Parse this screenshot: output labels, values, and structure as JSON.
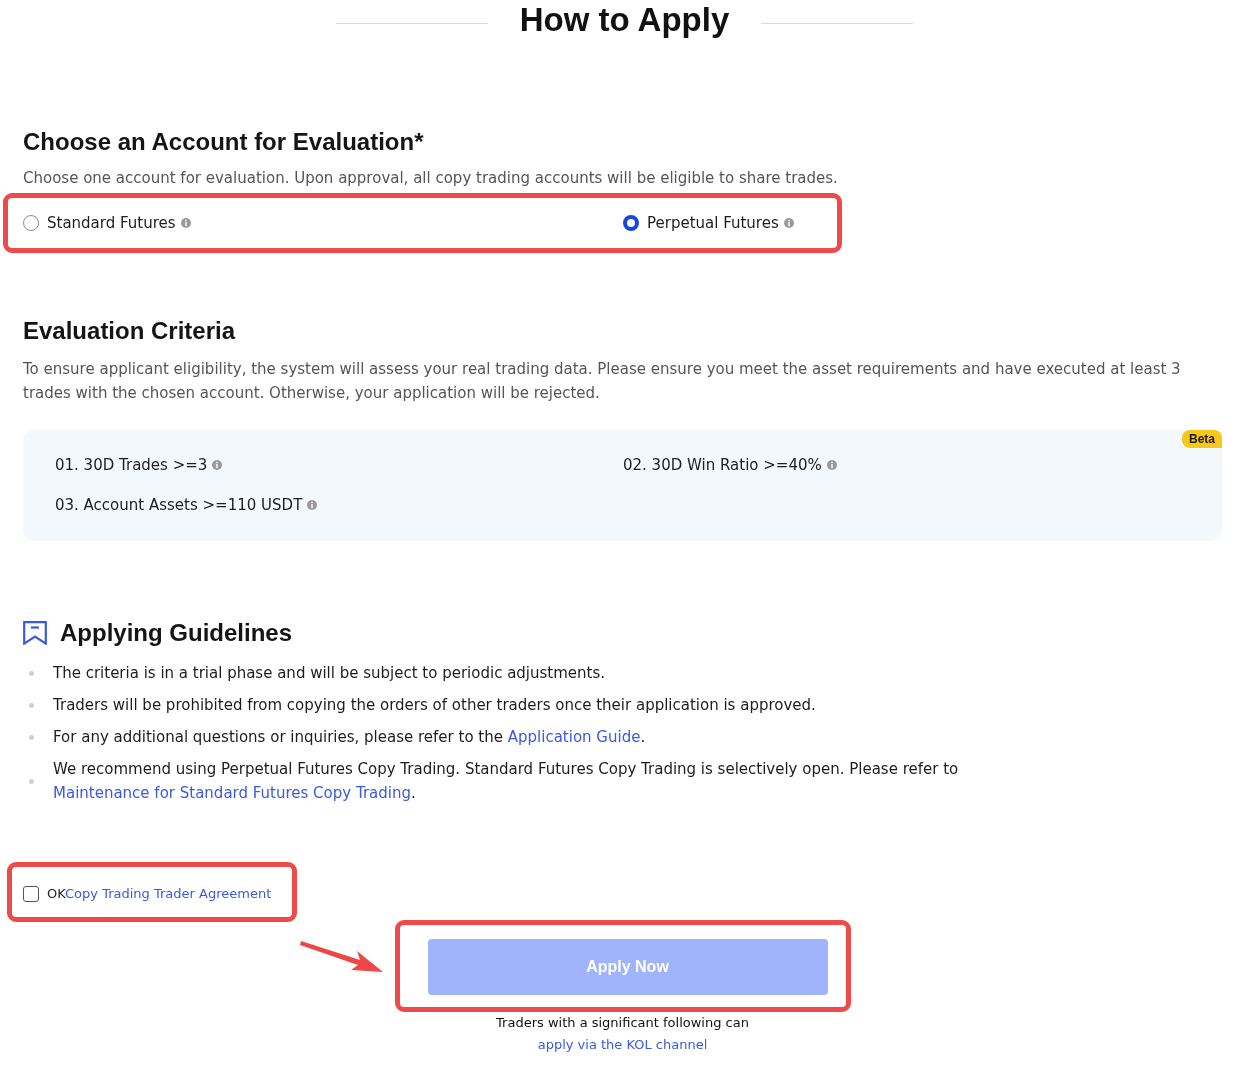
{
  "title": "How to Apply",
  "account": {
    "heading": "Choose an Account for Evaluation*",
    "description": "Choose one account for evaluation. Upon approval, all copy trading accounts will be eligible to share trades.",
    "options": [
      {
        "label": "Standard Futures",
        "selected": false
      },
      {
        "label": "Perpetual Futures",
        "selected": true
      }
    ]
  },
  "criteria": {
    "heading": "Evaluation Criteria",
    "description": "To ensure applicant eligibility, the system will assess your real trading data. Please ensure you meet the asset requirements and have executed at least 3 trades with the chosen account. Otherwise, your application will be rejected.",
    "badge": "Beta",
    "items": [
      "01. 30D Trades >=3",
      "02. 30D Win Ratio >=40%",
      "03. Account Assets >=110 USDT"
    ]
  },
  "guidelines": {
    "heading": "Applying Guidelines",
    "items": [
      [
        {
          "kind": "text",
          "text": "The criteria is in a trial phase and will be subject to periodic adjustments."
        }
      ],
      [
        {
          "kind": "text",
          "text": "Traders will be prohibited from copying the orders of other traders once their application is approved."
        }
      ],
      [
        {
          "kind": "text",
          "text": "For any additional questions or inquiries, please refer to the "
        },
        {
          "kind": "link",
          "text": "Application Guide"
        },
        {
          "kind": "text",
          "text": "."
        }
      ],
      [
        {
          "kind": "text",
          "text": "We recommend using Perpetual Futures Copy Trading. Standard Futures Copy Trading is selectively open. Please refer to "
        },
        {
          "kind": "link",
          "text": "Maintenance for Standard Futures Copy Trading"
        },
        {
          "kind": "text",
          "text": "."
        }
      ]
    ]
  },
  "agreement": {
    "checked": false,
    "text": "OK",
    "link": "Copy Trading Trader Agreement"
  },
  "apply_button": {
    "label": "Apply Now",
    "disabled": true
  },
  "footer": [
    {
      "kind": "text",
      "text": "Traders with a significant following can "
    },
    {
      "kind": "link",
      "text": "apply via the KOL channel"
    }
  ]
}
